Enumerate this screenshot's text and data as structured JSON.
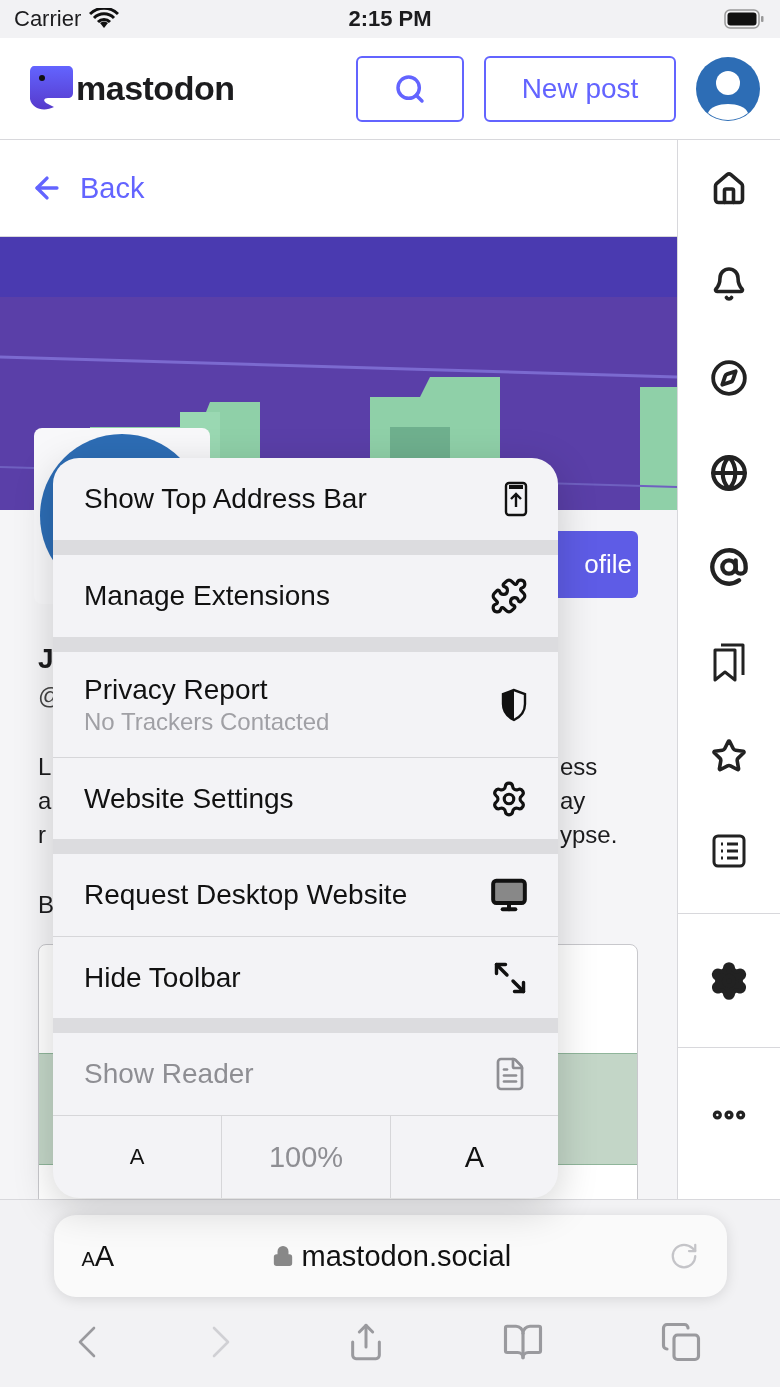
{
  "status_bar": {
    "carrier": "Carrier",
    "time": "2:15 PM"
  },
  "header": {
    "logo_text": "mastodon",
    "new_post": "New post"
  },
  "back": {
    "label": "Back"
  },
  "profile": {
    "button_fragment": "ofile",
    "name_fragment": "J",
    "handle_fragment": "@",
    "bio_lines": [
      {
        "left": "L",
        "right": "ess"
      },
      {
        "left": "a",
        "right": "ay"
      },
      {
        "left": "r",
        "right": "ypse."
      }
    ],
    "line_after": "B"
  },
  "menu": {
    "groups": [
      {
        "items": [
          {
            "label": "Show Top Address Bar",
            "disabled": false
          }
        ]
      },
      {
        "items": [
          {
            "label": "Manage Extensions",
            "disabled": false
          }
        ]
      },
      {
        "items": [
          {
            "label": "Privacy Report",
            "subtitle": "No Trackers Contacted",
            "disabled": false
          },
          {
            "label": "Website Settings",
            "disabled": false
          }
        ]
      },
      {
        "items": [
          {
            "label": "Request Desktop Website",
            "disabled": false
          },
          {
            "label": "Hide Toolbar",
            "disabled": false
          }
        ]
      },
      {
        "items": [
          {
            "label": "Show Reader",
            "disabled": true
          }
        ]
      }
    ],
    "zoom": {
      "smaller": "A",
      "reading": "100%",
      "larger": "A"
    }
  },
  "address_bar": {
    "text_size_small": "A",
    "text_size_large": "A",
    "url": "mastodon.social"
  },
  "toolbar": {
    "back_disabled": false,
    "forward_disabled": true
  }
}
